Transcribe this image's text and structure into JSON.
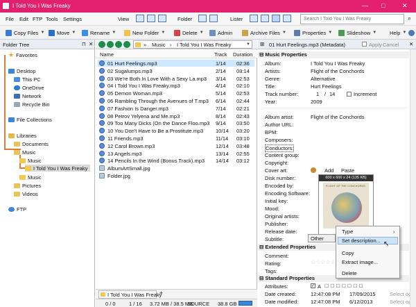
{
  "title": "I Told You I Was Freaky",
  "menu": [
    "File",
    "Edit",
    "FTP",
    "Tools",
    "Settings",
    "View",
    "Folder",
    "Lister"
  ],
  "search": {
    "placeholder": "Search I Told You I Was Freaky"
  },
  "toolbar": {
    "copy": "Copy Files",
    "move": "Move",
    "rename": "Rename",
    "new_folder": "New Folder",
    "delete": "Delete",
    "admin": "Admin",
    "archive": "Archive Files",
    "properties": "Properties",
    "slideshow": "Slideshow",
    "help": "Help"
  },
  "tree": {
    "title": "Folder Tree",
    "items": [
      "Favorites",
      "Desktop",
      "This PC",
      "OneDrive",
      "Network",
      "Recycle Bin",
      "File Collections",
      "Libraries",
      "Documents",
      "Music",
      "Music",
      "I Told You I Was Freaky",
      "Music",
      "Pictures",
      "Videos",
      "FTP"
    ]
  },
  "breadcrumb": {
    "a": "Music",
    "b": "I Told You I Was Freaky"
  },
  "columns": {
    "name": "Name",
    "track": "Track",
    "duration": "Duration"
  },
  "files": [
    {
      "name": "01 Hurt Feelings.mp3",
      "track": "1/14",
      "dur": "02:36"
    },
    {
      "name": "02 Sugalumps.mp3",
      "track": "2/14",
      "dur": "03:14"
    },
    {
      "name": "03 We're Both In Love With a Sexy La.mp3",
      "track": "3/14",
      "dur": "02:53"
    },
    {
      "name": "04 I Told You I Was Freaky.mp3",
      "track": "4/14",
      "dur": "02:10"
    },
    {
      "name": "05 Demon Woman.mp3",
      "track": "5/14",
      "dur": "02:53"
    },
    {
      "name": "06 Rambling Through the Avenues of T.mp3",
      "track": "6/14",
      "dur": "02:44"
    },
    {
      "name": "07 Fashion Is Danger.mp3",
      "track": "7/14",
      "dur": "02:21"
    },
    {
      "name": "08 Petrov Yelyena and Me.mp3",
      "track": "8/14",
      "dur": "02:43"
    },
    {
      "name": "09 Too Many Dicks (On the Dance Floo.mp3",
      "track": "9/14",
      "dur": "03:50"
    },
    {
      "name": "10 You Don't Have to Be a Prostitute.mp3",
      "track": "10/14",
      "dur": "03:20"
    },
    {
      "name": "11 Friends.mp3",
      "track": "11/14",
      "dur": "03:10"
    },
    {
      "name": "12 Carol Brown.mp3",
      "track": "12/14",
      "dur": "03:48"
    },
    {
      "name": "13 Angels.mp3",
      "track": "13/14",
      "dur": "02:55"
    },
    {
      "name": "14 Pencils In the Wind (Bonus Track).mp3",
      "track": "14/14",
      "dur": "03:12"
    },
    {
      "name": "AlbumArtSmall.jpg",
      "track": "",
      "dur": ""
    },
    {
      "name": "Folder.jpg",
      "track": "",
      "dur": ""
    }
  ],
  "meta": {
    "header": "01 Hurt Feelings.mp3 (Metadata)",
    "apply": "Apply",
    "cancel": "Cancel",
    "music_section": "Music Properties",
    "album_label": "Album:",
    "album": "I Told You I Was Freaky",
    "artists_label": "Artists:",
    "artists": "Flight of the Conchords",
    "genre_label": "Genre:",
    "genre": "Alternative",
    "title_label": "Title:",
    "title": "Hurt Feelings",
    "track_label": "Track number:",
    "track_no": "1",
    "track_of": "14",
    "increment": "Increment",
    "year_label": "Year:",
    "year": "2009",
    "album_artist_label": "Album artist:",
    "album_artist": "Flight of the Conchords",
    "author_url": "Author URL:",
    "bpm": "BPM:",
    "composers": "Composers:",
    "conductors": "Conductors:",
    "content_group": "Content group:",
    "copyright": "Copyright:",
    "cover_art": "Cover art:",
    "add": "Add",
    "paste": "Paste",
    "cover_size": "600 x 600 x 24 (135 KB)",
    "disc": "Disk number:",
    "encoded_by": "Encoded by:",
    "encoding_sw": "Encoding Software:",
    "initial_key": "Initial key:",
    "mood": "Mood:",
    "orig_artists": "Original artists:",
    "publisher": "Publisher:",
    "release": "Release date:",
    "subtitle": "Subtitle:",
    "ext_section": "Extended Properties",
    "comment": "Comment:",
    "rating": "Rating:",
    "tags": "Tags:",
    "std_section": "Standard Properties",
    "attributes": "Attributes:",
    "created_label": "Date created:",
    "created": "12:47:08 PM",
    "created_d": "17/09/2015",
    "modified_label": "Date modified:",
    "modified": "12:47:08 PM",
    "modified_d": "6/12/2013",
    "attrs": "A",
    "select_op": "Select op"
  },
  "context_menu": {
    "other": "Other",
    "type": "Type",
    "set_desc": "Set description...",
    "copy": "Copy",
    "extract": "Extract image...",
    "delete": "Delete"
  },
  "status": {
    "folders": "0 / 0",
    "files": "1 / 16",
    "size": "3.72 MB / 38.5 MB",
    "source": "SOURCE",
    "free": "38.8 GB"
  },
  "tab": "I Told You I Was Freaky"
}
